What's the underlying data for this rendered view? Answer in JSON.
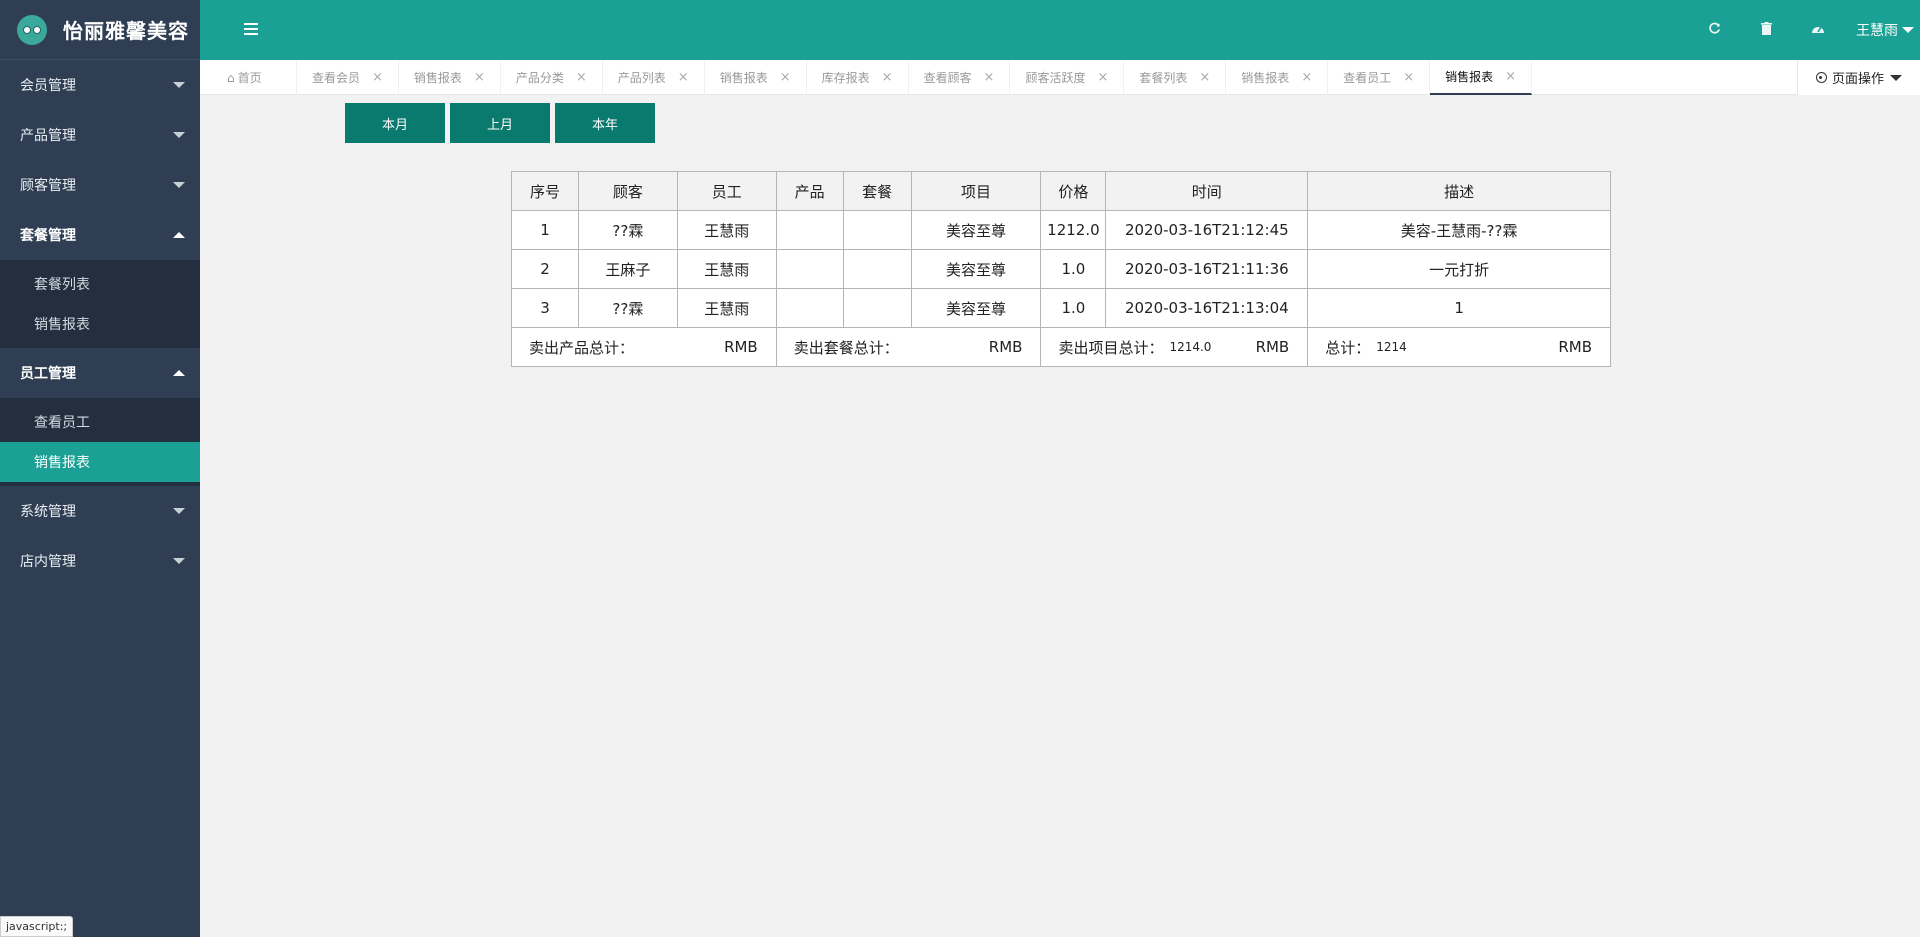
{
  "brand": {
    "title": "怡丽雅馨美容"
  },
  "sidebar": {
    "groups": [
      {
        "label": "会员管理",
        "open": false
      },
      {
        "label": "产品管理",
        "open": false
      },
      {
        "label": "顾客管理",
        "open": false
      },
      {
        "label": "套餐管理",
        "open": true,
        "items": [
          "套餐列表",
          "销售报表"
        ]
      },
      {
        "label": "员工管理",
        "open": true,
        "items": [
          "查看员工",
          "销售报表"
        ]
      },
      {
        "label": "系统管理",
        "open": false
      },
      {
        "label": "店内管理",
        "open": false
      }
    ]
  },
  "status_tip": "javascript:;",
  "topbar": {
    "user": "王慧雨",
    "icons": [
      "refresh-icon",
      "trash-icon",
      "dashboard-icon"
    ]
  },
  "tabs": [
    {
      "label": "首页",
      "home": true
    },
    {
      "label": "查看会员"
    },
    {
      "label": "销售报表"
    },
    {
      "label": "产品分类"
    },
    {
      "label": "产品列表"
    },
    {
      "label": "销售报表"
    },
    {
      "label": "库存报表"
    },
    {
      "label": "查看顾客"
    },
    {
      "label": "顾客活跃度"
    },
    {
      "label": "套餐列表"
    },
    {
      "label": "销售报表"
    },
    {
      "label": "查看员工"
    },
    {
      "label": "销售报表",
      "active": true
    }
  ],
  "page_ops": "页面操作",
  "period_buttons": [
    "本月",
    "上月",
    "本年"
  ],
  "table": {
    "headers": [
      "序号",
      "顾客",
      "员工",
      "产品",
      "套餐",
      "项目",
      "价格",
      "时间",
      "描述"
    ],
    "rows": [
      [
        "1",
        "??霖",
        "王慧雨",
        "",
        "",
        "美容至尊",
        "1212.0",
        "2020-03-16T21:12:45",
        "美容-王慧雨-??霖"
      ],
      [
        "2",
        "王麻子",
        "王慧雨",
        "",
        "",
        "美容至尊",
        "1.0",
        "2020-03-16T21:11:36",
        "一元打折"
      ],
      [
        "3",
        "??霖",
        "王慧雨",
        "",
        "",
        "美容至尊",
        "1.0",
        "2020-03-16T21:13:04",
        "1"
      ]
    ],
    "totals": {
      "product_label": "卖出产品总计：",
      "product_value": "",
      "product_unit": "RMB",
      "package_label": "卖出套餐总计：",
      "package_value": "",
      "package_unit": "RMB",
      "project_label": "卖出项目总计：",
      "project_value": "1214.0",
      "project_unit": "RMB",
      "total_label": "总计：",
      "total_value": "1214",
      "total_unit": "RMB"
    }
  }
}
